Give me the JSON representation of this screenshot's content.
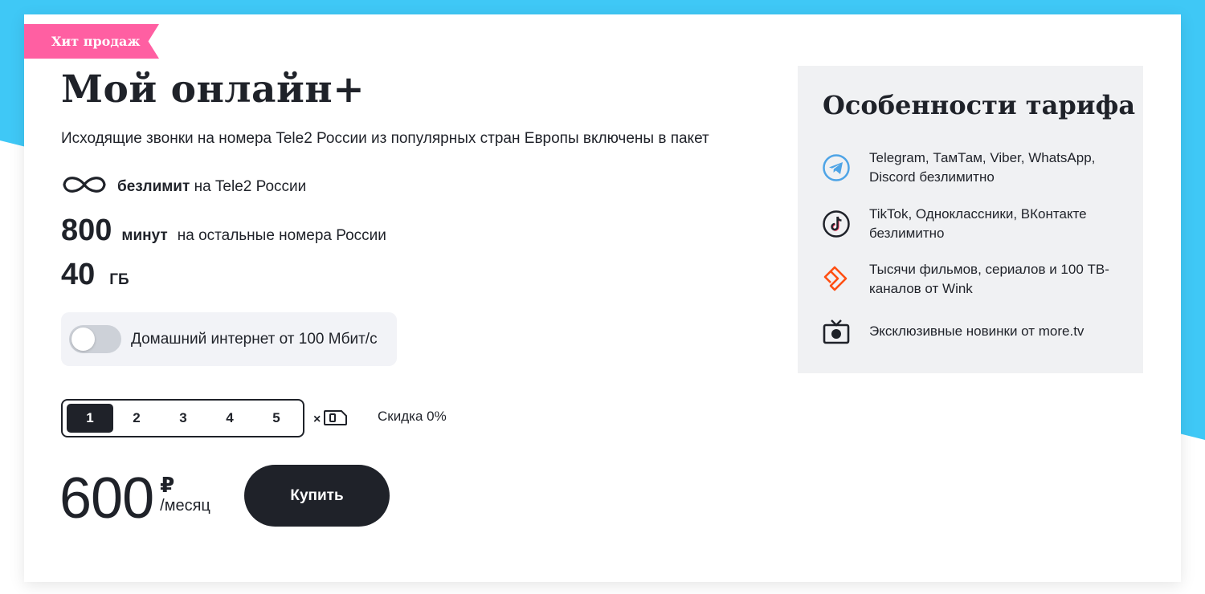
{
  "badge": "Хит продаж",
  "tariff": {
    "title": "Мой онлайн+",
    "subtitle": "Исходящие звонки на номера Tele2 России из популярных стран Европы включены в пакет",
    "unlimited_bold": "безлимит",
    "unlimited_rest": "на Tele2 России",
    "minutes_value": "800",
    "minutes_unit": "минут",
    "minutes_rest": "на остальные номера России",
    "data_value": "40",
    "data_unit": "ГБ"
  },
  "home_internet": {
    "label": "Домашний интернет от 100 Мбит/с",
    "enabled": false
  },
  "sim_selector": {
    "options": [
      "1",
      "2",
      "3",
      "4",
      "5"
    ],
    "selected": "1",
    "times_label": "×",
    "discount": "Скидка 0%"
  },
  "price": {
    "amount": "600",
    "currency": "₽",
    "period": "/месяц"
  },
  "buy_button": "Купить",
  "features": {
    "title": "Особенности тарифа",
    "items": [
      {
        "icon": "telegram-icon",
        "text": "Telegram, ТамТам, Viber, WhatsApp, Discord безлимитно"
      },
      {
        "icon": "tiktok-icon",
        "text": "TikTok, Одноклассники, ВКонтакте безлимитно"
      },
      {
        "icon": "wink-icon",
        "text": "Тысячи фильмов, сериалов и 100 ТВ-каналов от Wink"
      },
      {
        "icon": "tv-icon",
        "text": "Эксклюзивные новинки от more.tv"
      }
    ]
  },
  "colors": {
    "background": "#3fc8f6",
    "badge": "#ff5fa2",
    "dark": "#1f2229",
    "telegram": "#4ea4e6",
    "wink": "#ff4f12"
  }
}
